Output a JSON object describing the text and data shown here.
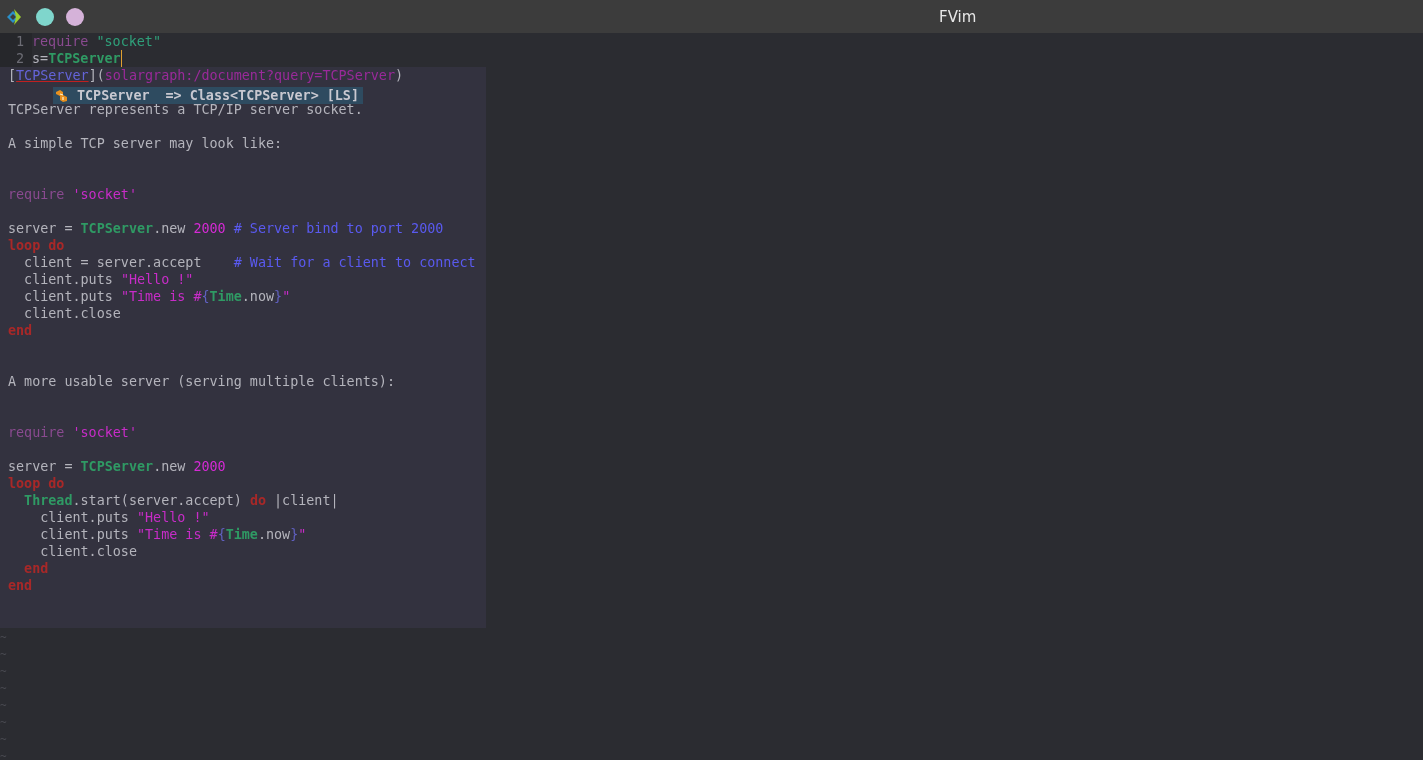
{
  "window": {
    "title": "FVim"
  },
  "editor": {
    "lines": [
      {
        "number": "1",
        "cursor": false,
        "tokens": [
          {
            "kind": "require",
            "text": "require"
          },
          {
            "kind": "editor_string",
            "text": " \"socket\""
          }
        ]
      },
      {
        "number": "2",
        "cursor": true,
        "tokens": [
          {
            "kind": "plain",
            "text": "s="
          },
          {
            "kind": "constant",
            "text": "TCPServer"
          }
        ]
      }
    ],
    "filler_lines": [
      "~",
      "~",
      "~",
      "~",
      "~",
      "~",
      "~",
      "~"
    ]
  },
  "hover_doc": {
    "lines": [
      {
        "kind": "text",
        "tokens": [
          {
            "kind": "plain",
            "text": "["
          },
          {
            "kind": "link_text",
            "text": "TCPServer"
          },
          {
            "kind": "plain",
            "text": "]("
          },
          {
            "kind": "url",
            "text": "solargraph:/document?query=TCPServer"
          },
          {
            "kind": "plain",
            "text": ")"
          }
        ]
      },
      {
        "kind": "blank"
      },
      {
        "kind": "text",
        "tokens": [
          {
            "kind": "plain",
            "text": "TCPServer represents a TCP/IP server socket."
          }
        ]
      },
      {
        "kind": "blank"
      },
      {
        "kind": "text",
        "tokens": [
          {
            "kind": "plain",
            "text": "A simple TCP server may look like:"
          }
        ]
      },
      {
        "kind": "blank"
      },
      {
        "kind": "blank"
      },
      {
        "kind": "code",
        "tokens": [
          {
            "kind": "require",
            "text": "require"
          },
          {
            "kind": "string",
            "text": " 'socket'"
          }
        ]
      },
      {
        "kind": "blank"
      },
      {
        "kind": "code",
        "tokens": [
          {
            "kind": "plain",
            "text": "server = "
          },
          {
            "kind": "constant",
            "text": "TCPServer"
          },
          {
            "kind": "plain",
            "text": ".new "
          },
          {
            "kind": "number",
            "text": "2000"
          },
          {
            "kind": "comment",
            "text": " # Server bind to port 2000"
          }
        ]
      },
      {
        "kind": "code",
        "tokens": [
          {
            "kind": "keyword",
            "text": "loop do"
          }
        ]
      },
      {
        "kind": "code",
        "tokens": [
          {
            "kind": "plain",
            "text": "  client = server.accept    "
          },
          {
            "kind": "comment",
            "text": "# Wait for a client to connect"
          }
        ]
      },
      {
        "kind": "code",
        "tokens": [
          {
            "kind": "plain",
            "text": "  client.puts "
          },
          {
            "kind": "string",
            "text": "\"Hello !\""
          }
        ]
      },
      {
        "kind": "code",
        "tokens": [
          {
            "kind": "plain",
            "text": "  client.puts "
          },
          {
            "kind": "string",
            "text": "\"Time is #"
          },
          {
            "kind": "interp",
            "text": "{"
          },
          {
            "kind": "constant",
            "text": "Time"
          },
          {
            "kind": "plain",
            "text": ".now"
          },
          {
            "kind": "interp",
            "text": "}"
          },
          {
            "kind": "string",
            "text": "\""
          }
        ]
      },
      {
        "kind": "code",
        "tokens": [
          {
            "kind": "plain",
            "text": "  client.close"
          }
        ]
      },
      {
        "kind": "code",
        "tokens": [
          {
            "kind": "keyword",
            "text": "end"
          }
        ]
      },
      {
        "kind": "blank"
      },
      {
        "kind": "blank"
      },
      {
        "kind": "text",
        "tokens": [
          {
            "kind": "plain",
            "text": "A more usable server (serving multiple clients):"
          }
        ]
      },
      {
        "kind": "blank"
      },
      {
        "kind": "blank"
      },
      {
        "kind": "code",
        "tokens": [
          {
            "kind": "require",
            "text": "require"
          },
          {
            "kind": "string",
            "text": " 'socket'"
          }
        ]
      },
      {
        "kind": "blank"
      },
      {
        "kind": "code",
        "tokens": [
          {
            "kind": "plain",
            "text": "server = "
          },
          {
            "kind": "constant",
            "text": "TCPServer"
          },
          {
            "kind": "plain",
            "text": ".new "
          },
          {
            "kind": "number",
            "text": "2000"
          }
        ]
      },
      {
        "kind": "code",
        "tokens": [
          {
            "kind": "keyword",
            "text": "loop do"
          }
        ]
      },
      {
        "kind": "code",
        "tokens": [
          {
            "kind": "constant",
            "text": "  Thread"
          },
          {
            "kind": "plain",
            "text": ".start(server.accept) "
          },
          {
            "kind": "keyword",
            "text": "do"
          },
          {
            "kind": "plain",
            "text": " |client|"
          }
        ]
      },
      {
        "kind": "code",
        "tokens": [
          {
            "kind": "plain",
            "text": "    client.puts "
          },
          {
            "kind": "string",
            "text": "\"Hello !\""
          }
        ]
      },
      {
        "kind": "code",
        "tokens": [
          {
            "kind": "plain",
            "text": "    client.puts "
          },
          {
            "kind": "string",
            "text": "\"Time is #"
          },
          {
            "kind": "interp",
            "text": "{"
          },
          {
            "kind": "constant",
            "text": "Time"
          },
          {
            "kind": "plain",
            "text": ".now"
          },
          {
            "kind": "interp",
            "text": "}"
          },
          {
            "kind": "string",
            "text": "\""
          }
        ]
      },
      {
        "kind": "code",
        "tokens": [
          {
            "kind": "plain",
            "text": "    client.close"
          }
        ]
      },
      {
        "kind": "code",
        "tokens": [
          {
            "kind": "keyword",
            "text": "  end"
          }
        ]
      },
      {
        "kind": "code",
        "tokens": [
          {
            "kind": "keyword",
            "text": "end"
          }
        ]
      },
      {
        "kind": "blank"
      },
      {
        "kind": "blank"
      }
    ]
  },
  "completion": {
    "items": [
      {
        "label": "TCPServer",
        "detail": "=> Class<TCPServer>",
        "source": "[LS]",
        "selected": true
      }
    ]
  }
}
